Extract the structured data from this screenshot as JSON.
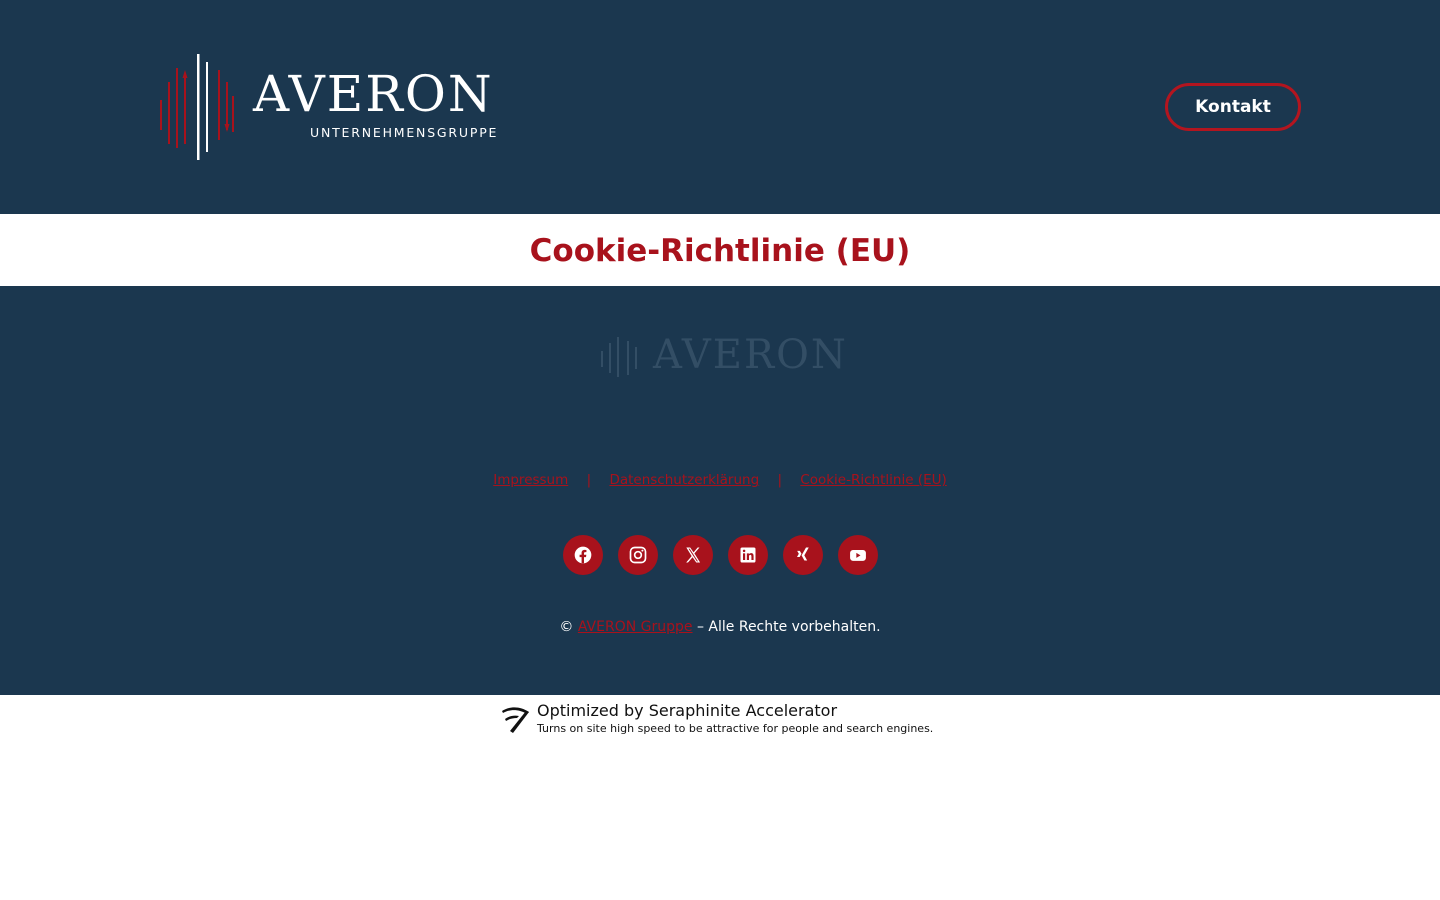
{
  "header": {
    "logo": {
      "name": "AVERON",
      "subline": "UNTERNEHMENSGRUPPE"
    },
    "contact_button": "Kontakt"
  },
  "page": {
    "title": "Cookie-Richtlinie (EU)"
  },
  "footer": {
    "logo_name": "AVERON",
    "links": [
      {
        "label": "Impressum"
      },
      {
        "label": "Datenschutzerklärung"
      },
      {
        "label": "Cookie-Richtlinie (EU)"
      }
    ],
    "separator": "|",
    "social": [
      {
        "icon": "facebook-icon"
      },
      {
        "icon": "instagram-icon"
      },
      {
        "icon": "x-twitter-icon"
      },
      {
        "icon": "linkedin-icon"
      },
      {
        "icon": "xing-icon"
      },
      {
        "icon": "youtube-icon"
      }
    ],
    "copyright": {
      "symbol": "©",
      "company": "AVERON Gruppe",
      "suffix": "– Alle Rechte vorbehalten."
    }
  },
  "badge": {
    "title": "Optimized by Seraphinite Accelerator",
    "subtitle": "Turns on site high speed to be attractive for people and search engines."
  },
  "colors": {
    "navy": "#1b374f",
    "accent_red": "#a8121c",
    "white": "#ffffff"
  }
}
